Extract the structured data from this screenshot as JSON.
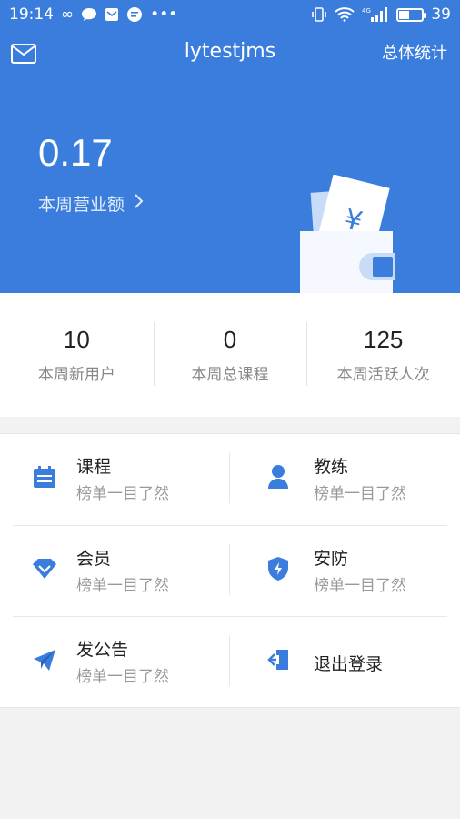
{
  "status_bar": {
    "time": "19:14",
    "battery": "39",
    "network": "4G"
  },
  "header": {
    "title": "lytestjms",
    "stats_link": "总体统计",
    "revenue_value": "0.17",
    "revenue_label": "本周营业额",
    "wallet_symbol": "¥"
  },
  "stats": [
    {
      "value": "10",
      "label": "本周新用户"
    },
    {
      "value": "0",
      "label": "本周总课程"
    },
    {
      "value": "125",
      "label": "本周活跃人次"
    }
  ],
  "menu": {
    "course": {
      "title": "课程",
      "subtitle": "榜单一目了然"
    },
    "coach": {
      "title": "教练",
      "subtitle": "榜单一目了然"
    },
    "member": {
      "title": "会员",
      "subtitle": "榜单一目了然"
    },
    "security": {
      "title": "安防",
      "subtitle": "榜单一目了然"
    },
    "announce": {
      "title": "发公告",
      "subtitle": "榜单一目了然"
    },
    "logout": {
      "title": "退出登录"
    }
  },
  "colors": {
    "primary": "#3b7ddd",
    "icon": "#3b7ddd"
  }
}
